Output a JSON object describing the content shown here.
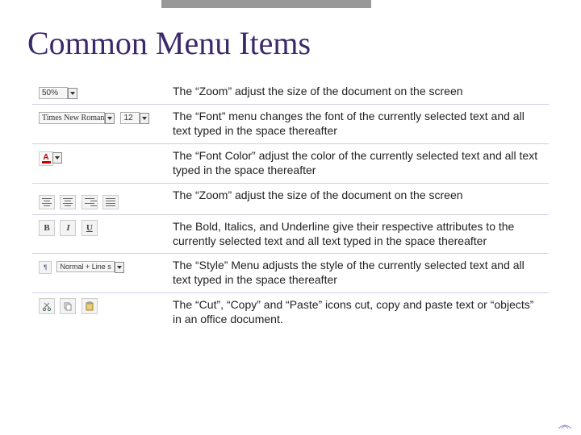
{
  "title": "Common Menu Items",
  "rows": [
    {
      "desc": "The “Zoom” adjust the size of the document on the screen",
      "zoom": "50%"
    },
    {
      "desc": "The “Font” menu changes the font of the currently selected text and all text typed in the space thereafter",
      "fontName": "Times New Roman",
      "fontSize": "12"
    },
    {
      "desc": "The “Font Color” adjust the color of the currently selected text and all text typed in the space thereafter"
    },
    {
      "desc": "The “Zoom” adjust the size of the document on the screen"
    },
    {
      "desc": "The Bold, Italics, and Underline give their respective attributes to the currently selected text and all text typed in the space thereafter",
      "b": "B",
      "i": "I",
      "u": "U"
    },
    {
      "desc": "The “Style” Menu adjusts the style of the currently selected text and all text typed in the space thereafter",
      "style": "Normal + Line s"
    },
    {
      "desc": "The “Cut”, “Copy” and “Paste” icons cut, copy and paste text or “objects” in an office document."
    }
  ]
}
